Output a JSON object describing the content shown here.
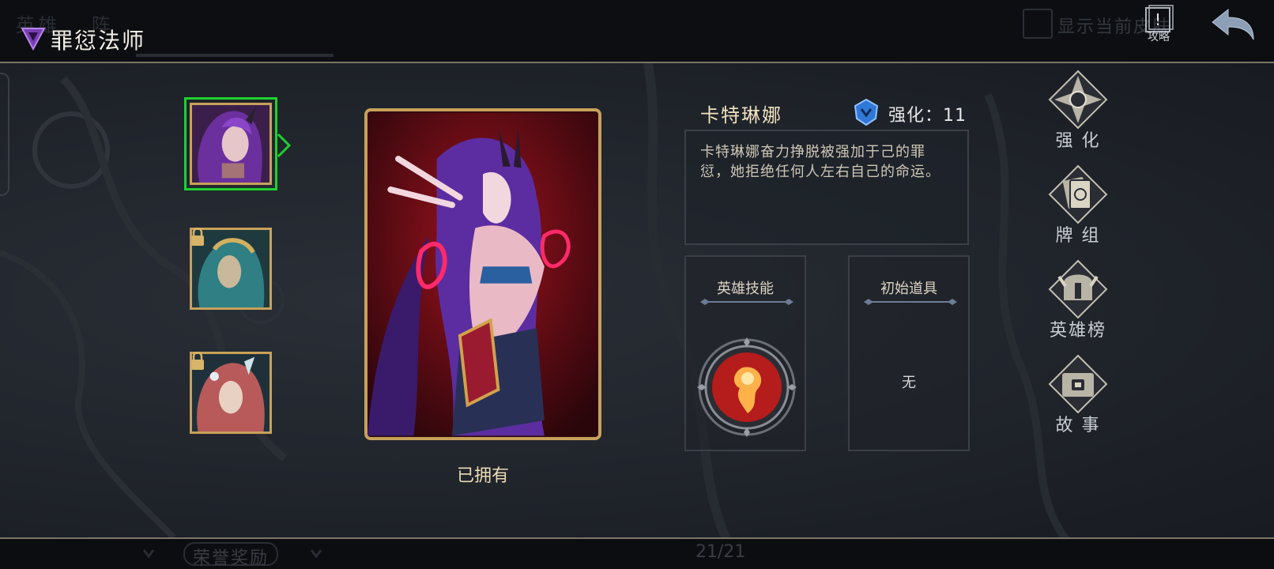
{
  "top_bar": {
    "ghost_tabs": [
      "英雄",
      "阵"
    ],
    "class_title": "罪愆法师",
    "show_current_label": "显示当前皮肤",
    "guide_label": "攻略"
  },
  "hero": {
    "name": "卡特琳娜",
    "enhance_label": "强化：11",
    "description": "卡特琳娜奋力挣脱被强加于己的罪愆，她拒绝任何人左右自己的命运。",
    "owned_label": "已拥有"
  },
  "skills_panel": {
    "title": "英雄技能"
  },
  "items_panel": {
    "title": "初始道具",
    "value": "无"
  },
  "right_menu": [
    {
      "label": "强 化",
      "icon": "enhance-compass-icon"
    },
    {
      "label": "牌 组",
      "icon": "deck-cards-icon"
    },
    {
      "label": "英雄榜",
      "icon": "hero-ranking-helmet-icon"
    },
    {
      "label": "故 事",
      "icon": "story-book-icon"
    }
  ],
  "bottom_bar": {
    "honor_rewards": "荣誉奖励",
    "page_counter": "21/21"
  },
  "colors": {
    "gold_frame": "#c8a15a",
    "selection_green": "#1fd12f",
    "panel_bg": "#1f232a",
    "text_cream": "#f0e2be"
  }
}
